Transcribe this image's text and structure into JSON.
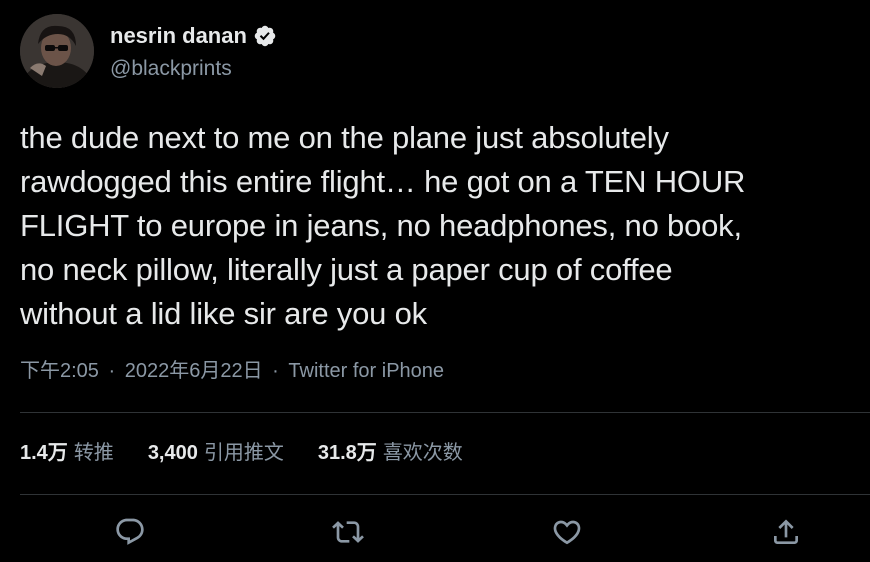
{
  "author": {
    "display_name": "nesrin danan",
    "handle": "@blackprints",
    "verified": true,
    "verified_icon": "verified-badge-icon"
  },
  "tweet": {
    "text": "the dude next to me on the plane just absolutely\nrawdogged this entire flight… he got on a TEN HOUR\nFLIGHT to europe in jeans, no headphones, no book,\nno neck pillow, literally just a paper cup of coffee\nwithout a lid like sir are you ok",
    "time": "下午2:05",
    "date": "2022年6月22日",
    "separator": "·",
    "source": "Twitter for iPhone"
  },
  "stats": {
    "retweets": {
      "value": "1.4万",
      "label": "转推"
    },
    "quotes": {
      "value": "3,400",
      "label": "引用推文"
    },
    "likes": {
      "value": "31.8万",
      "label": "喜欢次数"
    }
  },
  "actions": {
    "reply": "reply-icon",
    "retweet": "retweet-icon",
    "like": "heart-icon",
    "share": "share-icon"
  },
  "colors": {
    "background": "#000000",
    "primary_text": "#e7e9ea",
    "secondary_text": "#8b98a5",
    "divider": "#2f3336"
  }
}
